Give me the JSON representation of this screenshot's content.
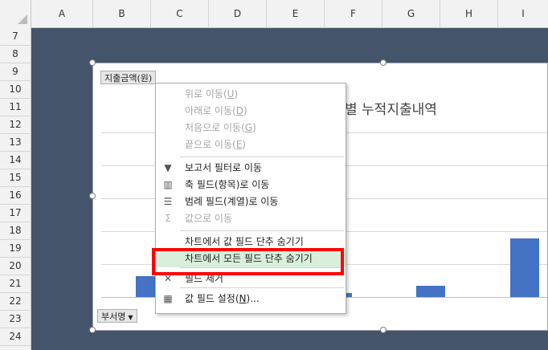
{
  "columns": [
    "A",
    "B",
    "C",
    "D",
    "E",
    "F",
    "G",
    "H",
    "I"
  ],
  "rows": [
    "7",
    "8",
    "9",
    "10",
    "11",
    "12",
    "13",
    "14",
    "15",
    "16",
    "17",
    "18",
    "19",
    "20",
    "21",
    "22",
    "23",
    "24"
  ],
  "chart": {
    "title_partial": "별 누적지출내역",
    "value_field_button": "지출금액(원)",
    "axis_field_button": "부서명",
    "axis_field_arrow": "▼",
    "bar_color": "#4472c4",
    "chart_data": {
      "type": "bar",
      "values": [
        26,
        5,
        14,
        73
      ]
    }
  },
  "menu": {
    "items": [
      {
        "label": "위로 이동",
        "mnemonic": "U",
        "disabled": true,
        "icon": ""
      },
      {
        "label": "아래로 이동",
        "mnemonic": "D",
        "disabled": true,
        "icon": ""
      },
      {
        "label": "처음으로 이동",
        "mnemonic": "G",
        "disabled": true,
        "icon": ""
      },
      {
        "label": "끝으로 이동",
        "mnemonic": "E",
        "disabled": true,
        "icon": ""
      },
      {
        "label": "보고서 필터로 이동",
        "disabled": false,
        "icon": "filter-icon"
      },
      {
        "label": "축 필드(항목)로 이동",
        "disabled": false,
        "icon": "axis-field-icon"
      },
      {
        "label": "범례 필드(계열)로 이동",
        "disabled": false,
        "icon": "legend-field-icon"
      },
      {
        "label": "값으로 이동",
        "disabled": true,
        "icon": "sigma-icon"
      },
      {
        "label": "차트에서 값 필드 단추 숨기기",
        "disabled": false,
        "icon": ""
      },
      {
        "label": "차트에서 모든 필드 단추 숨기기",
        "disabled": false,
        "icon": "",
        "highlighted": true
      },
      {
        "label": "필드 제거",
        "disabled": false,
        "icon": "remove-x-icon"
      },
      {
        "label": "값 필드 설정",
        "mnemonic": "N",
        "suffix": "...",
        "disabled": false,
        "icon": "field-settings-icon"
      }
    ]
  },
  "colors": {
    "sheet_background": "#44546a",
    "highlight_border": "#ff0000",
    "highlight_fill": "#d9efdc"
  }
}
